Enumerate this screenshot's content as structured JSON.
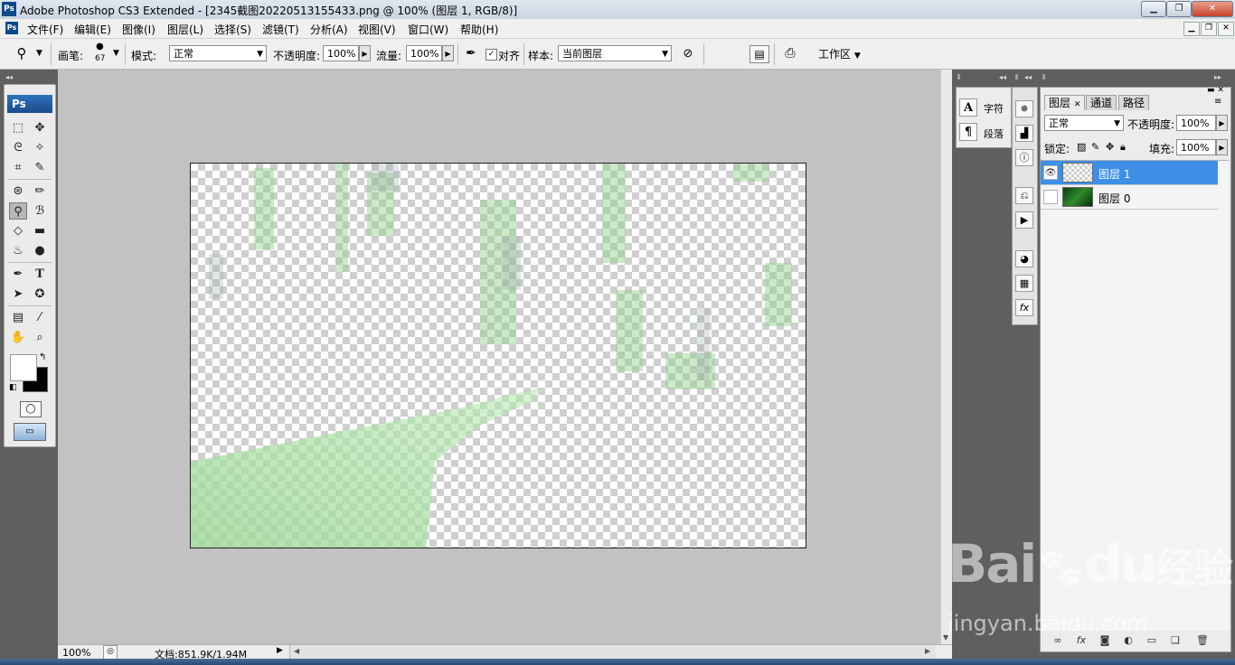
{
  "title_bar": {
    "app_icon_text": "Ps",
    "title": "Adobe Photoshop CS3 Extended - [2345截图20220513155433.png @ 100% (图层 1, RGB/8)]"
  },
  "menu": {
    "app_icon_text": "Ps",
    "items": [
      "文件(F)",
      "编辑(E)",
      "图像(I)",
      "图层(L)",
      "选择(S)",
      "滤镜(T)",
      "分析(A)",
      "视图(V)",
      "窗口(W)",
      "帮助(H)"
    ]
  },
  "options_bar": {
    "brush_label": "画笔:",
    "brush_size": "67",
    "mode_label": "模式:",
    "mode_value": "正常",
    "opacity_label": "不透明度:",
    "opacity_value": "100%",
    "flow_label": "流量:",
    "flow_value": "100%",
    "aligned_label": "对齐",
    "aligned_checked": true,
    "sample_label": "样本:",
    "sample_value": "当前图层",
    "workspace_label": "工作区"
  },
  "toolbox": {
    "logo": "Ps"
  },
  "status_bar": {
    "zoom": "100%",
    "doc_info": "文档:851.9K/1.94M"
  },
  "char_panel": {
    "character_label": "字符",
    "paragraph_label": "段落"
  },
  "layers_panel": {
    "tabs": [
      "图层",
      "通道",
      "路径"
    ],
    "blend_mode": "正常",
    "opacity_label": "不透明度:",
    "opacity_value": "100%",
    "lock_label": "锁定:",
    "fill_label": "填充:",
    "fill_value": "100%",
    "layers": [
      {
        "name": "图层 1",
        "visible": true,
        "selected": true
      },
      {
        "name": "图层 0",
        "visible": false,
        "selected": false
      }
    ]
  },
  "watermark": {
    "brand": "Bai",
    "brand_suffix": "du",
    "product": "经验",
    "url": "jingyan.baidu.com"
  },
  "colors": {
    "workspace_bg": "#c2c2c2",
    "dock_bg": "#5f5f5f",
    "selected_layer": "#3d8fe8",
    "canvas_green": "#a8e0a0"
  }
}
